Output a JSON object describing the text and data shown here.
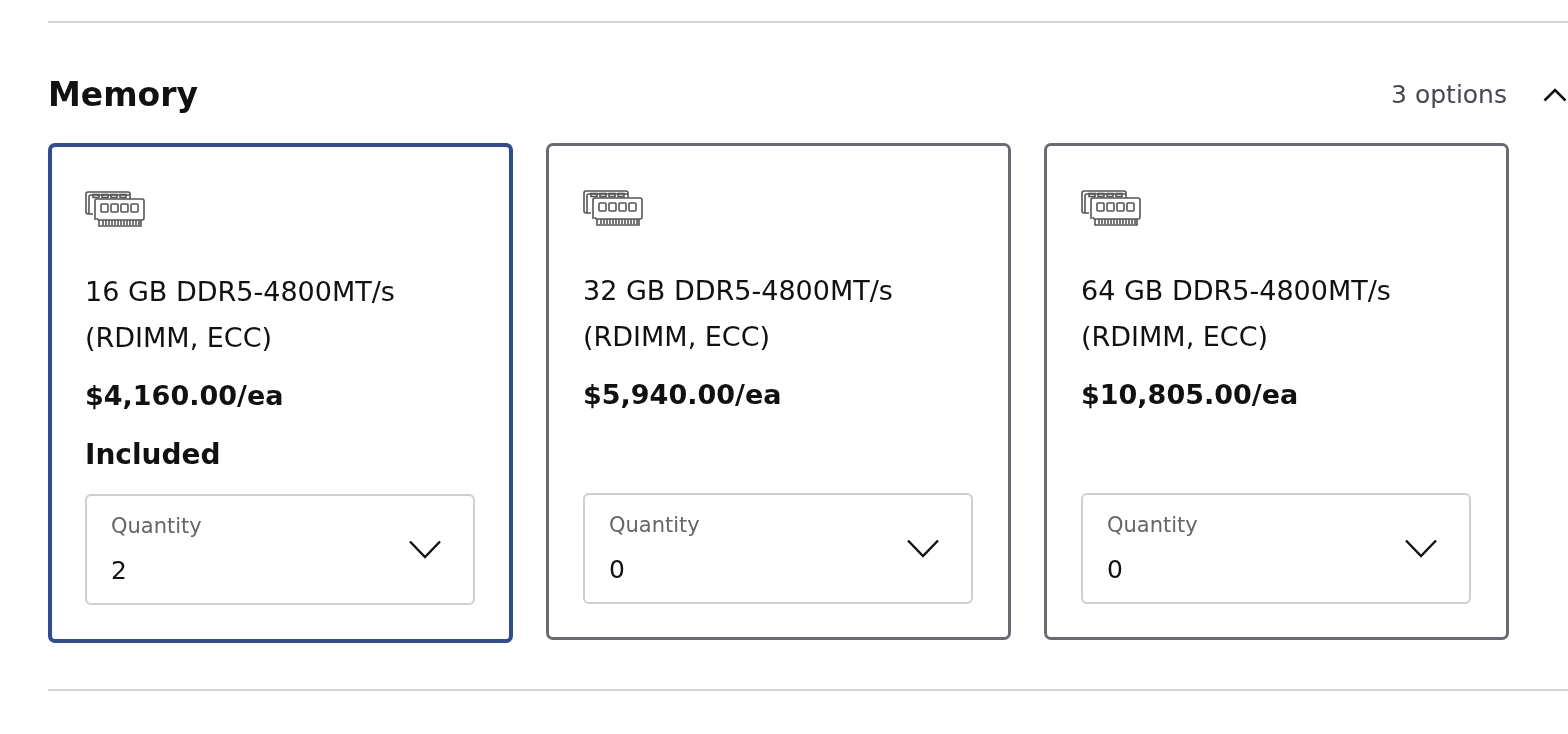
{
  "section": {
    "title": "Memory",
    "option_count": "3 options",
    "expanded": true
  },
  "options": [
    {
      "name": "16 GB DDR5-4800MT/s (RDIMM, ECC)",
      "price": "$4,160.00/ea",
      "status": "Included",
      "selected": true,
      "quantity": {
        "label": "Quantity",
        "value": "2"
      }
    },
    {
      "name": "32 GB DDR5-4800MT/s (RDIMM, ECC)",
      "price": "$5,940.00/ea",
      "selected": false,
      "quantity": {
        "label": "Quantity",
        "value": "0"
      }
    },
    {
      "name": "64 GB DDR5-4800MT/s (RDIMM, ECC)",
      "price": "$10,805.00/ea",
      "selected": false,
      "quantity": {
        "label": "Quantity",
        "value": "0"
      }
    }
  ]
}
